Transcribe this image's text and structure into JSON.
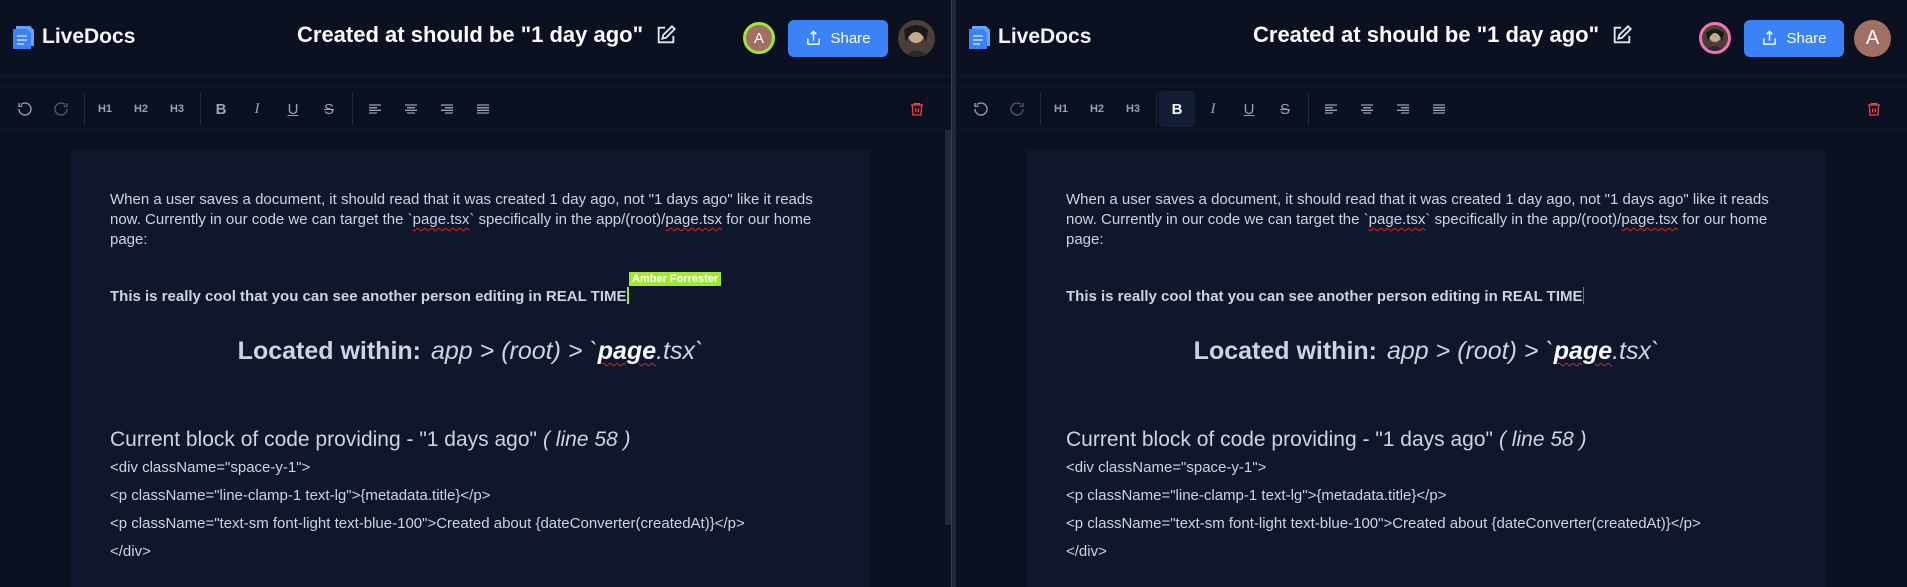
{
  "panes": [
    {
      "app_name": "LiveDocs",
      "doc_title": "Created at should be \"1 day ago\"",
      "presence_initial": "A",
      "share_label": "Share",
      "toolbar": {
        "h1": "H1",
        "h2": "H2",
        "h3": "H3",
        "bold": "B",
        "italic": "I",
        "underline": "U",
        "strike": "S"
      },
      "content": {
        "para_a": "When a user saves a document, it should read that it was created 1 day ago, not \"1 days ago\" like it reads now. Currently in our code we can target the `",
        "para_file": "page.tsx",
        "para_b": "` specifically in the app/(root)/",
        "para_file2": "page.tsx",
        "para_c": " for our home page:",
        "bold_line": "This is really cool that you can see another person editing in REAL TIME",
        "cursor_user": "Amber Forrester",
        "located_label": "Located within:",
        "located_path_a": "app > (root) > `",
        "located_path_page": "page",
        "located_path_b": ".tsx`",
        "code_heading": "Current block of code providing - \"1 days ago\"",
        "code_heading_line": "( line 58 )",
        "code_1": "<div className=\"space-y-1\">",
        "code_2": "<p className=\"line-clamp-1 text-lg\">{metadata.title}</p>",
        "code_3": "<p className=\"text-sm font-light text-blue-100\">Created about {dateConverter(createdAt)}</p>",
        "code_4": "</div>"
      }
    },
    {
      "app_name": "LiveDocs",
      "doc_title": "Created at should be \"1 day ago\"",
      "share_label": "Share",
      "user_initial": "A",
      "toolbar": {
        "h1": "H1",
        "h2": "H2",
        "h3": "H3",
        "bold": "B",
        "italic": "I",
        "underline": "U",
        "strike": "S"
      },
      "content": {
        "para_a": "When a user saves a document, it should read that it was created 1 day ago, not \"1 days ago\" like it reads now. Currently in our code we can target the `",
        "para_file": "page.tsx",
        "para_b": "` specifically in the app/(root)/",
        "para_file2": "page.tsx",
        "para_c": " for our home page:",
        "bold_line": "This is really cool that you can see another person editing in REAL TIME",
        "located_label": "Located within:",
        "located_path_a": "app > (root) > `",
        "located_path_page": "page",
        "located_path_b": ".tsx`",
        "code_heading": "Current block of code providing - \"1 days ago\"",
        "code_heading_line": "( line 58 )",
        "code_1": "<div className=\"space-y-1\">",
        "code_2": "<p className=\"line-clamp-1 text-lg\">{metadata.title}</p>",
        "code_3": "<p className=\"text-sm font-light text-blue-100\">Created about {dateConverter(createdAt)}</p>",
        "code_4": "</div>"
      }
    }
  ],
  "colors": {
    "background": "#0b1120",
    "editor_bg": "#0e172b",
    "accent": "#3b82f6",
    "collab_cursor": "#a3e635",
    "delete": "#ef4444",
    "avatar_brown": "#a16f63"
  },
  "icons": [
    "document-logo-icon",
    "edit-icon",
    "share-icon",
    "undo-icon",
    "redo-icon",
    "align-left-icon",
    "align-center-icon",
    "align-right-icon",
    "align-justify-icon",
    "trash-icon"
  ]
}
